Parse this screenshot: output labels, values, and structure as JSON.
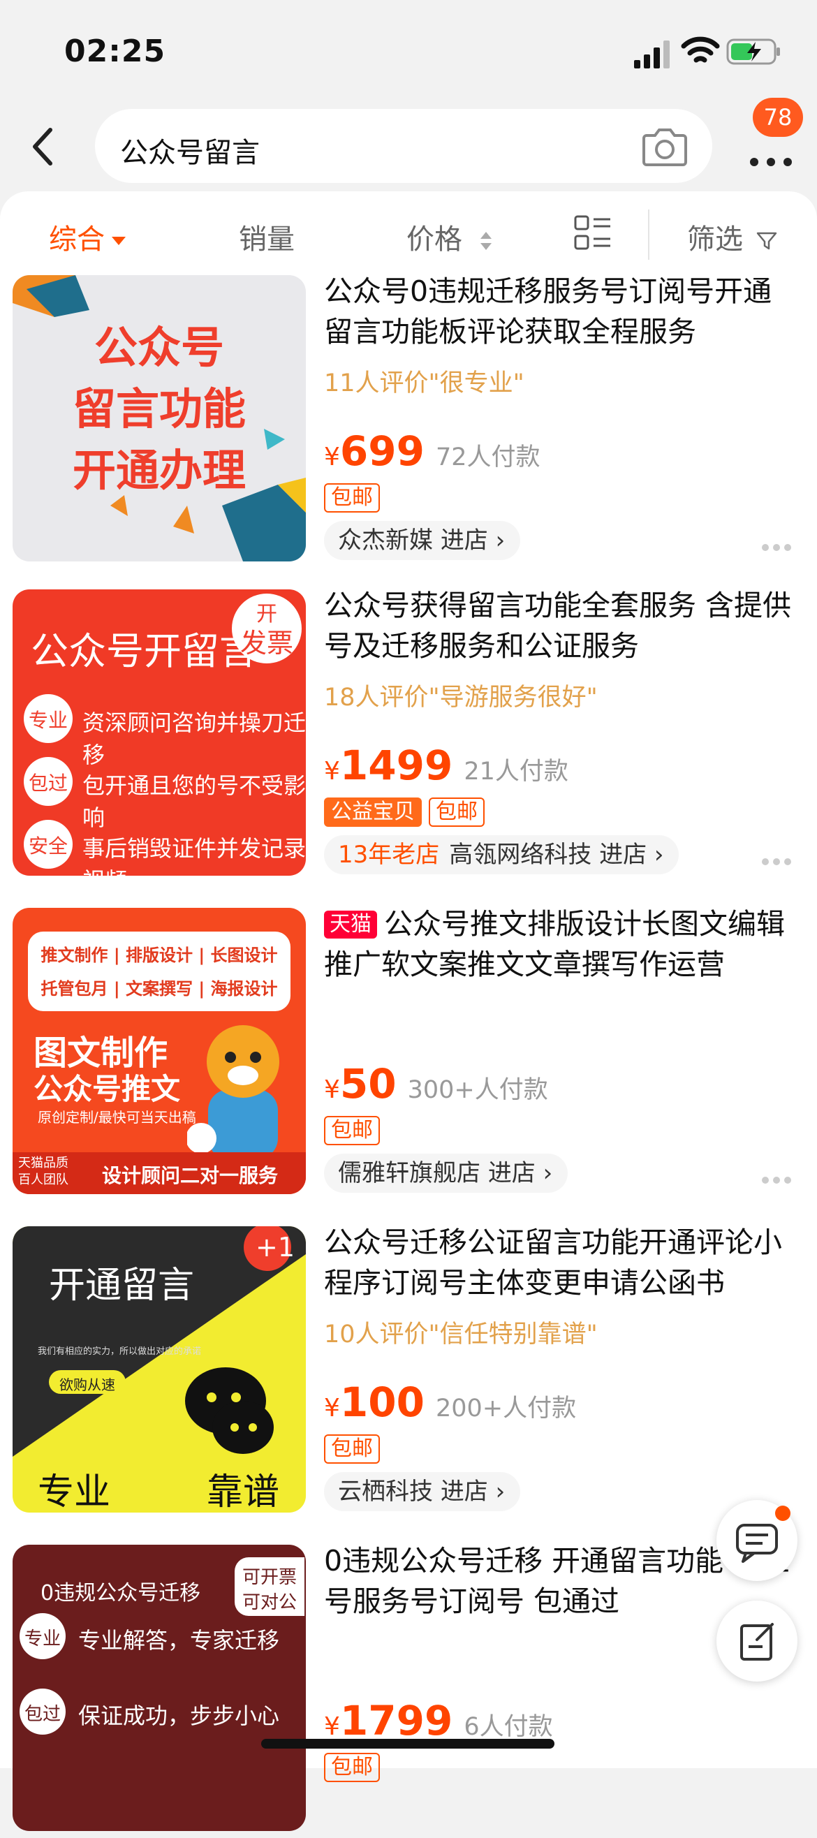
{
  "status": {
    "time": "02:25"
  },
  "search": {
    "query": "公众号留言",
    "badge_count": "78"
  },
  "sort": {
    "items": [
      "综合",
      "销量",
      "价格",
      "筛选"
    ]
  },
  "colors": {
    "accent": "#ff5000",
    "price": "#ff4400",
    "review": "#e2a14b"
  },
  "products": [
    {
      "title": "公众号0违规迁移服务号订阅号开通留言功能板评论获取全程服务",
      "review": "11人评价\"很专业\"",
      "price": "699",
      "paid": "72人付款",
      "tags": [
        "包邮"
      ],
      "store": "众杰新媒",
      "store_enter": "进店",
      "thumb": {
        "l1": "公众号",
        "l2": "留言功能",
        "l3": "开通办理"
      }
    },
    {
      "title": "公众号获得留言功能全套服务 含提供号及迁移服务和公证服务",
      "review": "18人评价\"导游服务很好\"",
      "price": "1499",
      "paid": "21人付款",
      "tags": [
        "公益宝贝",
        "包邮"
      ],
      "store_badge": "13年老店",
      "store": "高瓴网络科技",
      "store_enter": "进店",
      "thumb": {
        "head": "公众号开留言",
        "corner1": "开",
        "corner2": "发票",
        "rows": [
          {
            "k": "专业",
            "v": "资深顾问咨询并操刀迁移"
          },
          {
            "k": "包过",
            "v": "包开通且您的号不受影响"
          },
          {
            "k": "安全",
            "v": "事后销毁证件并发记录视频"
          }
        ]
      }
    },
    {
      "tmall": "天猫",
      "title": "公众号推文排版设计长图文编辑推广软文案推文文章撰写作运营",
      "price": "50",
      "paid": "300+人付款",
      "tags": [
        "包邮"
      ],
      "store": "儒雅轩旗舰店",
      "store_enter": "进店",
      "thumb": {
        "b1": "推文制作 | 排版设计 | 长图设计",
        "b2": "托管包月 | 文案撰写 | 海报设计",
        "big1": "图文制作",
        "big2": "公众号推文",
        "small": "原创定制/最快可当天出稿",
        "team1": "天猫品质",
        "team2": "百人团队",
        "foot": "设计顾问二对一服务"
      }
    },
    {
      "title": "公众号迁移公证留言功能开通评论小程序订阅号主体变更申请公函书",
      "review": "10人评价\"信任特别靠谱\"",
      "price": "100",
      "paid": "200+人付款",
      "tags": [
        "包邮"
      ],
      "store": "云栖科技",
      "store_enter": "进店",
      "thumb": {
        "head": "开通留言",
        "plus": "+1",
        "sub": "我们有相应的实力，所以做出对应的承诺",
        "pill": "欲购从速",
        "left": "专业",
        "right": "靠谱"
      }
    },
    {
      "title": "0违规公众号迁移 开通留言功能 企业号服务号订阅号 包通过",
      "price": "1799",
      "paid": "6人付款",
      "tags": [
        "包邮"
      ],
      "thumb": {
        "head": "0违规公众号迁移",
        "corner1": "可开票",
        "corner2": "可对公",
        "rows": [
          {
            "k": "专业",
            "v": "专业解答，专家迁移"
          },
          {
            "k": "包过",
            "v": "保证成功，步步小心"
          }
        ]
      }
    }
  ]
}
